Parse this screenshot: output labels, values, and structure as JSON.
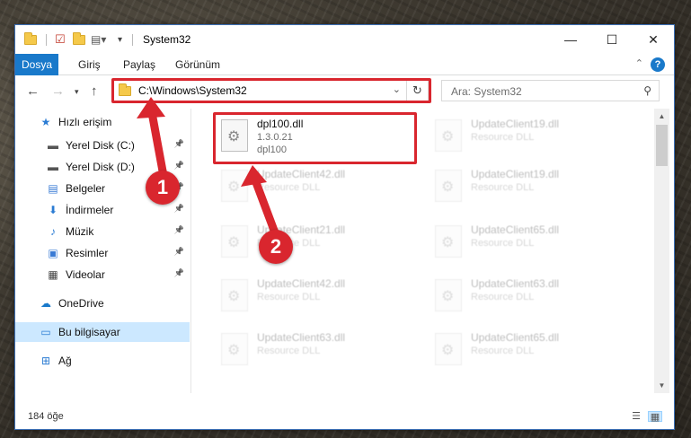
{
  "window": {
    "title": "System32"
  },
  "titlebar": {
    "minimize_icon": "minimize-icon",
    "maximize_icon": "maximize-icon",
    "close_icon": "close-icon"
  },
  "ribbon": {
    "tabs": [
      {
        "label": "Dosya",
        "active": true
      },
      {
        "label": "Giriş"
      },
      {
        "label": "Paylaş"
      },
      {
        "label": "Görünüm"
      }
    ],
    "help": "?"
  },
  "address": {
    "path": "C:\\Windows\\System32",
    "refresh_icon": "refresh-icon"
  },
  "search": {
    "placeholder": "Ara: System32"
  },
  "sidebar": {
    "items": [
      {
        "label": "Hızlı erişim",
        "icon": "star-icon",
        "glyph": "★",
        "color": "#2b7cd3"
      },
      {
        "label": "Yerel Disk (C:)",
        "icon": "drive-icon",
        "glyph": "▬",
        "color": "#555",
        "pinned": true
      },
      {
        "label": "Yerel Disk (D:)",
        "icon": "drive-icon",
        "glyph": "▬",
        "color": "#555",
        "pinned": true
      },
      {
        "label": "Belgeler",
        "icon": "documents-icon",
        "glyph": "▤",
        "color": "#3a7bd5",
        "pinned": true
      },
      {
        "label": "İndirmeler",
        "icon": "download-icon",
        "glyph": "⬇",
        "color": "#2b7cd3",
        "pinned": true
      },
      {
        "label": "Müzik",
        "icon": "music-icon",
        "glyph": "♪",
        "color": "#2b7cd3",
        "pinned": true
      },
      {
        "label": "Resimler",
        "icon": "pictures-icon",
        "glyph": "▣",
        "color": "#3a7bd5",
        "pinned": true
      },
      {
        "label": "Videolar",
        "icon": "videos-icon",
        "glyph": "▦",
        "color": "#444",
        "pinned": true
      },
      {
        "label": "OneDrive",
        "icon": "onedrive-icon",
        "glyph": "☁",
        "color": "#1979ca"
      },
      {
        "label": "Bu bilgisayar",
        "icon": "computer-icon",
        "glyph": "▭",
        "color": "#2b7cd3",
        "active": true
      },
      {
        "label": "Ağ",
        "icon": "network-icon",
        "glyph": "⊞",
        "color": "#2b7cd3"
      }
    ]
  },
  "files": [
    {
      "name": "dpl100.dll",
      "l2": "1.3.0.21",
      "l3": "dpl100",
      "faded": false
    },
    {
      "name": "UpdateClient19.dll",
      "l2": "Resource DLL",
      "faded": true
    },
    {
      "name": "UpdateClient42.dll",
      "l2": "Resource DLL",
      "faded": true
    },
    {
      "name": "UpdateClient19.dll",
      "l2": "Resource DLL",
      "faded": true
    },
    {
      "name": "UpdateClient21.dll",
      "l2": "Resource DLL",
      "faded": true
    },
    {
      "name": "UpdateClient65.dll",
      "l2": "Resource DLL",
      "faded": true
    },
    {
      "name": "UpdateClient42.dll",
      "l2": "Resource DLL",
      "faded": true
    },
    {
      "name": "UpdateClient63.dll",
      "l2": "Resource DLL",
      "faded": true
    },
    {
      "name": "UpdateClient63.dll",
      "l2": "Resource DLL",
      "faded": true
    },
    {
      "name": "UpdateClient65.dll",
      "l2": "Resource DLL",
      "faded": true
    }
  ],
  "status": {
    "count": "184 öğe"
  },
  "annotations": {
    "step1": "1",
    "step2": "2",
    "accent": "#d9262e"
  }
}
